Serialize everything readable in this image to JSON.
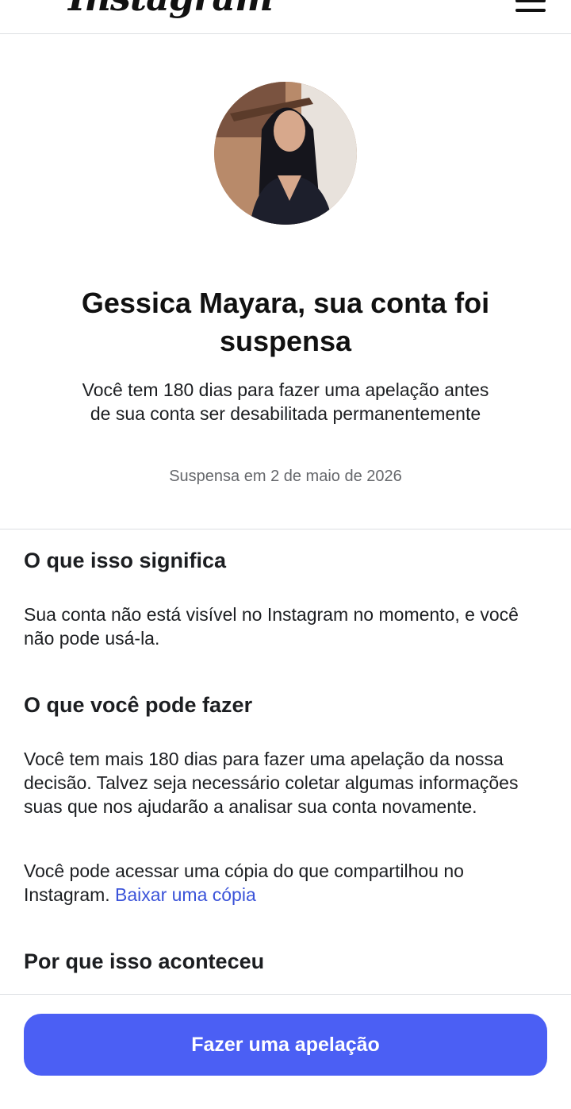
{
  "header": {
    "logo_text": "Instagram",
    "menu_icon": "hamburger-menu-icon"
  },
  "profile": {
    "avatar_icon": "profile-photo"
  },
  "hero": {
    "title": "Gessica Mayara, sua conta foi suspensa",
    "subtitle": "Você tem 180 dias para fazer uma apelação antes de sua conta ser desabilitada permanentemente",
    "date": "Suspensa em 2 de maio de 2026"
  },
  "sections": {
    "meaning": {
      "heading": "O que isso significa",
      "body": "Sua conta não está visível no Instagram no momento, e você não pode usá-la."
    },
    "what_to_do": {
      "heading": "O que você pode fazer",
      "body1": "Você tem mais 180 dias para fazer uma apelação da nossa decisão. Talvez seja necessário coletar algumas informações suas que nos ajudarão a analisar sua conta novamente.",
      "body2_text": "Você pode acessar uma cópia do que compartilhou no Instagram.",
      "body2_link": "Baixar uma cópia"
    },
    "why": {
      "heading": "Por que isso aconteceu"
    }
  },
  "footer": {
    "appeal_button": "Fazer uma apelação"
  },
  "colors": {
    "accent": "#4b5ff4",
    "link": "#3b53d9",
    "muted_text": "#65676b",
    "divider": "#dcdfe3"
  }
}
